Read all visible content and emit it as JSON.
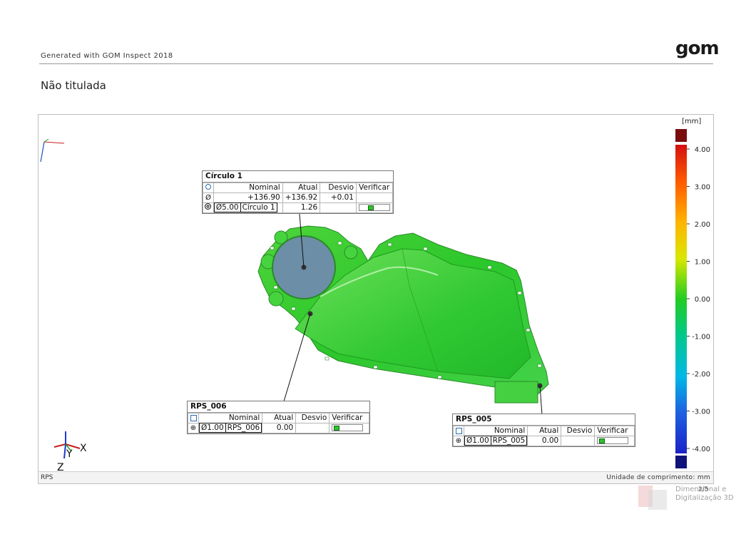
{
  "header": {
    "generated": "Generated with GOM Inspect 2018",
    "logo": "gom",
    "title": "Não titulada"
  },
  "viewport": {
    "footer_left": "RPS",
    "footer_right": "Unidade de comprimento: mm",
    "axis_labels": {
      "x": "X",
      "y": "Y",
      "z": "Z"
    }
  },
  "colorbar": {
    "unit": "[mm]",
    "ticks": [
      "4.00",
      "3.00",
      "2.00",
      "1.00",
      "0.00",
      "-1.00",
      "-2.00",
      "-3.00",
      "-4.00"
    ],
    "over_color": "#7a0c0c",
    "under_color": "#0f1278"
  },
  "labels": {
    "circle": {
      "title": "Círculo 1",
      "headers": [
        "Nominal",
        "Atual",
        "Desvio",
        "Verificar"
      ],
      "row1_icon": "Ø",
      "row1": {
        "nominal": "+136.90",
        "atual": "+136.92",
        "desvio": "+0.01"
      },
      "row2_tolerance": "Ø5.00",
      "row2_ref": "Círculo 1",
      "row2_atual": "1.26"
    },
    "rps006": {
      "title": "RPS_006",
      "headers": [
        "Nominal",
        "Atual",
        "Desvio",
        "Verificar"
      ],
      "tolerance": "Ø1.00",
      "ref": "RPS_006",
      "atual": "0.00"
    },
    "rps005": {
      "title": "RPS_005",
      "headers": [
        "Nominal",
        "Atual",
        "Desvio",
        "Verificar"
      ],
      "tolerance": "Ø1.00",
      "ref": "RPS_005",
      "atual": "0.00"
    }
  },
  "page": {
    "number": "2/5"
  },
  "watermark": {
    "line1": "Dimensional e",
    "line2": "Digitalização 3D"
  }
}
